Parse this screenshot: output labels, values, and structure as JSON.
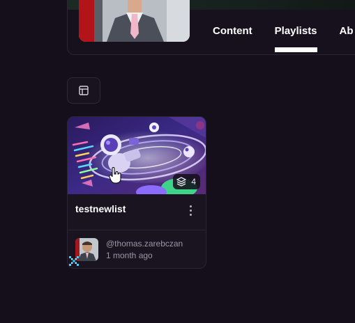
{
  "header": {
    "tabs": [
      {
        "label": "Content",
        "active": false
      },
      {
        "label": "Playlists",
        "active": true
      },
      {
        "label": "Ab",
        "active": false
      }
    ]
  },
  "view_toggle": {
    "icon": "layout-icon"
  },
  "playlist_card": {
    "title": "testnewlist",
    "item_count": "4",
    "author_handle": "@thomas.zarebczan",
    "time_ago": "1 month ago"
  }
}
